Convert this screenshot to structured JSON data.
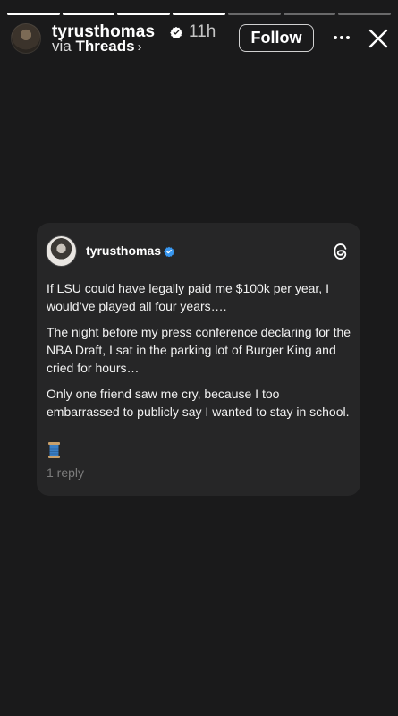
{
  "story": {
    "progress_segments": [
      1,
      1,
      1,
      1,
      0,
      0,
      0
    ],
    "header": {
      "username": "tyrusthomas",
      "timestamp": "11h",
      "via_prefix": "via",
      "via_app": "Threads",
      "via_chevron": "›",
      "follow_label": "Follow",
      "more_icon": "more-horizontal-icon",
      "close_icon": "close-icon"
    }
  },
  "card": {
    "username": "tyrusthomas",
    "verified_color": "#3897f0",
    "paragraphs": [
      "If LSU could have legally paid me $100k per year, I would’ve played all four years….",
      "The night before my press conference declaring for the NBA Draft, I sat in the parking lot of Burger King and cried for hours…",
      "Only one friend saw me cry, because I too embarrassed to publicly say I wanted to stay in school."
    ],
    "thread_emoji": "🧵",
    "reply_count": "1 reply"
  },
  "colors": {
    "background": "#1a1a1b",
    "card_background": "#262627",
    "muted_text": "#7c7c7c"
  }
}
